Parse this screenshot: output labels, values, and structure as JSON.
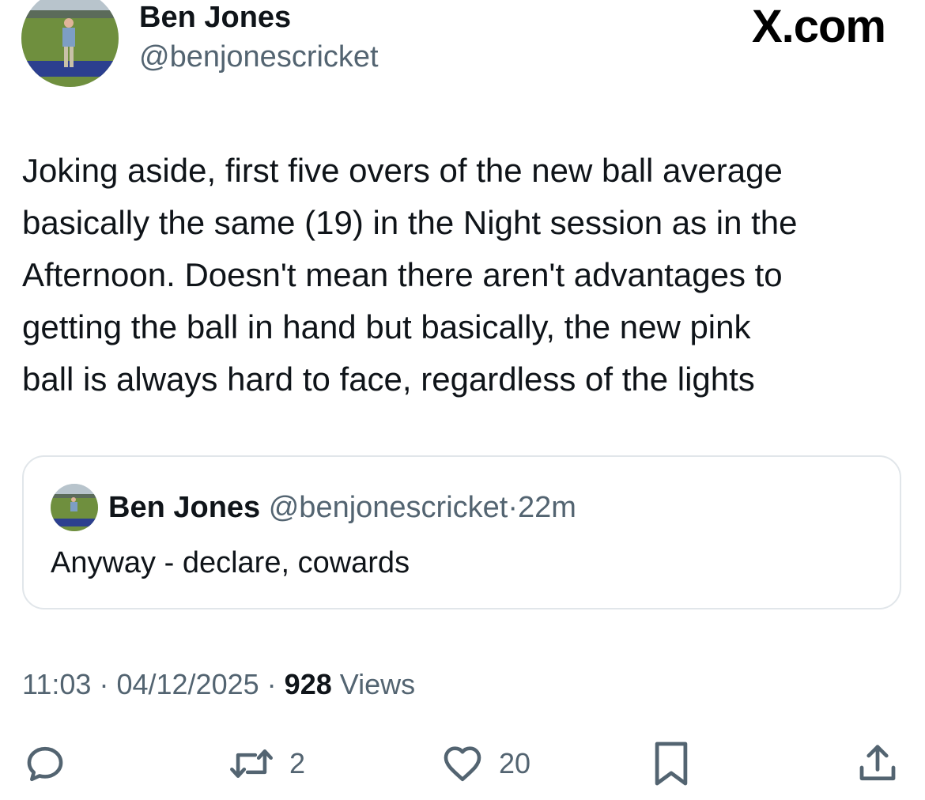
{
  "author": {
    "display_name": "Ben Jones",
    "handle": "@benjonescricket",
    "avatar": "profile-photo"
  },
  "brand": "X.com",
  "tweet": {
    "text": "Joking aside, first five overs of the new ball average\nbasically the same (19) in the Night session as in the\nAfternoon. Doesn't mean there aren't advantages to\ngetting the ball in hand but basically, the new pink\nball is always hard to face, regardless of the lights"
  },
  "quoted": {
    "display_name": "Ben Jones",
    "handle": "@benjonescricket",
    "separator": "·",
    "time": "22m",
    "text": "Anyway - declare, cowards"
  },
  "meta": {
    "time": "11:03",
    "separator": "·",
    "date": "04/12/2025",
    "views_count": "928",
    "views_label": "Views"
  },
  "actions": {
    "reply": {
      "icon": "reply-icon",
      "count": ""
    },
    "repost": {
      "icon": "repost-icon",
      "count": "2"
    },
    "like": {
      "icon": "heart-icon",
      "count": "20"
    },
    "bookmark": {
      "icon": "bookmark-icon",
      "count": ""
    },
    "share": {
      "icon": "share-icon",
      "count": ""
    }
  },
  "colors": {
    "text_primary": "#0f1419",
    "text_secondary": "#536471",
    "border": "#e1e6ea"
  }
}
